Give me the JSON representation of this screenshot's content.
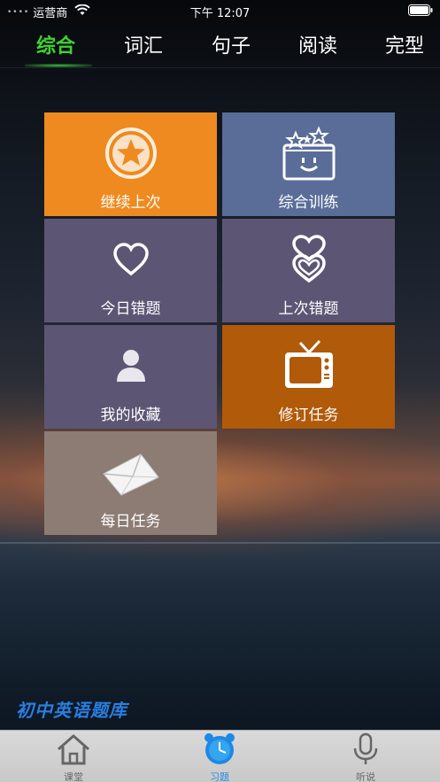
{
  "status_bar": {
    "signal_dots": "••••",
    "carrier": "运营商",
    "time": "下午 12:07"
  },
  "tabs": [
    {
      "label": "综合",
      "active": true
    },
    {
      "label": "词汇",
      "active": false
    },
    {
      "label": "句子",
      "active": false
    },
    {
      "label": "阅读",
      "active": false
    },
    {
      "label": "完型",
      "active": false
    }
  ],
  "tiles": [
    {
      "label": "继续上次",
      "icon": "star-circle-icon",
      "color": "#ee8a1f"
    },
    {
      "label": "综合训练",
      "icon": "smile-box-icon",
      "color": "#5a6d98"
    },
    {
      "label": "今日错题",
      "icon": "heart-icon",
      "color": "#5c5674"
    },
    {
      "label": "上次错题",
      "icon": "double-heart-icon",
      "color": "#5c5674"
    },
    {
      "label": "我的收藏",
      "icon": "person-icon",
      "color": "#5c5674"
    },
    {
      "label": "修订任务",
      "icon": "tv-icon",
      "color": "#b05a0a"
    },
    {
      "label": "每日任务",
      "icon": "envelope-icon",
      "color": "#8c7c74"
    }
  ],
  "brand": "初中英语题库",
  "bottom_nav": [
    {
      "label": "课堂",
      "icon": "house-icon",
      "active": false
    },
    {
      "label": "习题",
      "icon": "alarm-clock-icon",
      "active": true
    },
    {
      "label": "听说",
      "icon": "microphone-icon",
      "active": false
    }
  ]
}
